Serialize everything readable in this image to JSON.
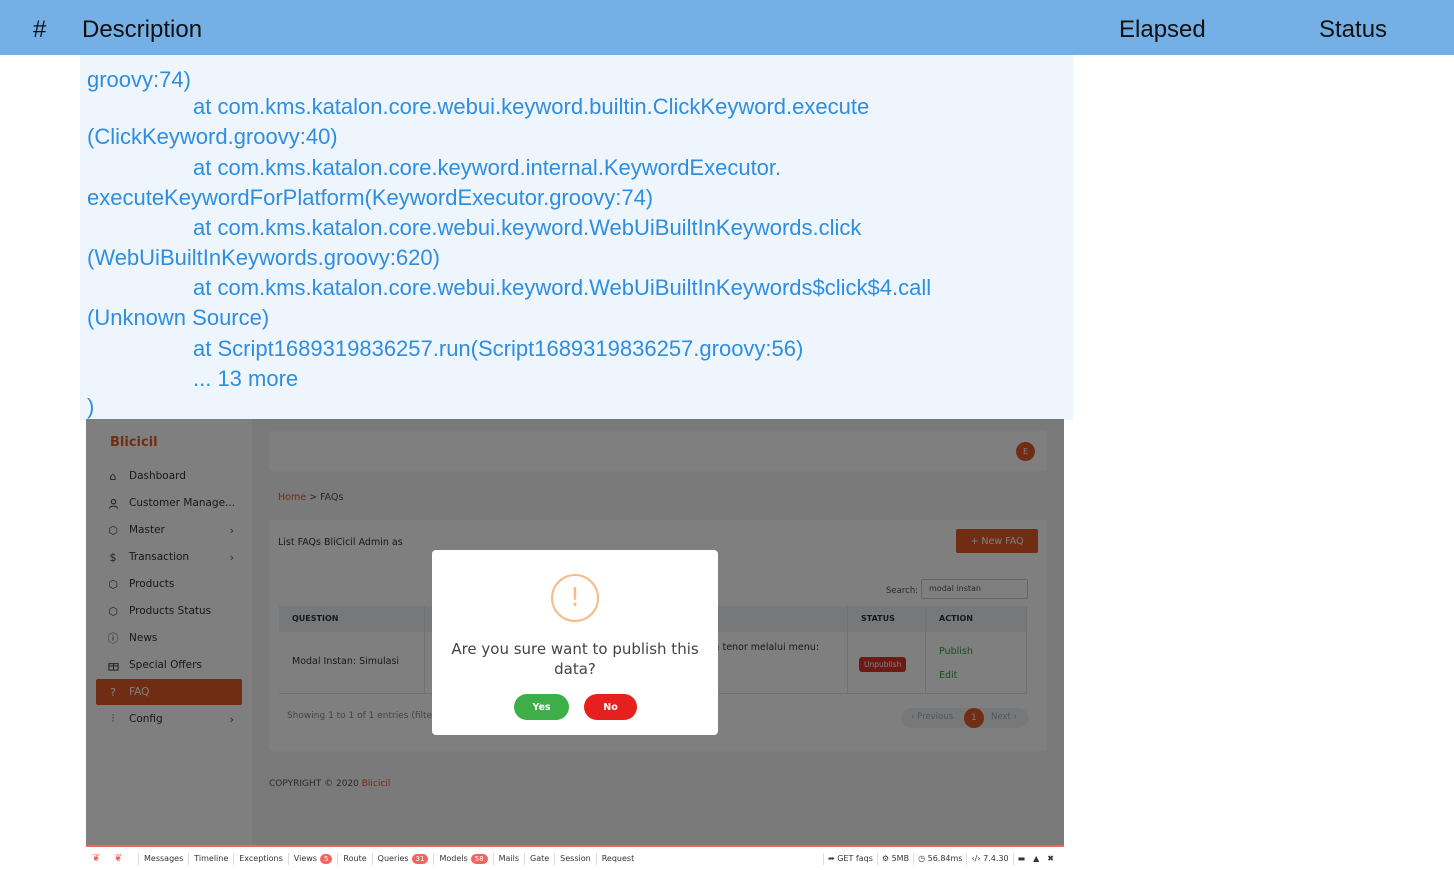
{
  "report_header": {
    "hash": "#",
    "description": "Description",
    "elapsed": "Elapsed",
    "status": "Status"
  },
  "log_lines": [
    "groovy:74)",
    "at com.kms.katalon.core.webui.keyword.builtin.ClickKeyword.execute",
    "(ClickKeyword.groovy:40)",
    "at com.kms.katalon.core.keyword.internal.KeywordExecutor.",
    "executeKeywordForPlatform(KeywordExecutor.groovy:74)",
    "at com.kms.katalon.core.webui.keyword.WebUiBuiltInKeywords.click",
    "(WebUiBuiltInKeywords.groovy:620)",
    "at com.kms.katalon.core.webui.keyword.WebUiBuiltInKeywords$click$4.call",
    "(Unknown Source)",
    "at Script1689319836257.run(Script1689319836257.groovy:56)",
    "... 13 more",
    ")"
  ],
  "app": {
    "brand": "Blicicil",
    "avatar_initial": "E",
    "menu": [
      {
        "label": "Dashboard",
        "icon": "home-icon"
      },
      {
        "label": "Customer Manage...",
        "icon": "user-icon"
      },
      {
        "label": "Master",
        "icon": "cube-icon",
        "chevron": "›"
      },
      {
        "label": "Transaction",
        "icon": "dollar-icon",
        "chevron": "›"
      },
      {
        "label": "Products",
        "icon": "cube-icon"
      },
      {
        "label": "Products Status",
        "icon": "cube-icon"
      },
      {
        "label": "News",
        "icon": "info-icon"
      },
      {
        "label": "Special Offers",
        "icon": "gift-icon"
      },
      {
        "label": "FAQ",
        "icon": "help-icon",
        "active": true
      },
      {
        "label": "Config",
        "icon": "sliders-icon",
        "chevron": "›"
      }
    ],
    "breadcrumb": {
      "home": "Home",
      "separator": ">",
      "current": "FAQs"
    },
    "card": {
      "title": "List FAQs BliCicil Admin as",
      "new_button": "+ New FAQ",
      "search_label": "Search:",
      "search_value": "modal instan"
    },
    "table": {
      "headers": [
        "QUESTION",
        "",
        "STATUS",
        "ACTION"
      ],
      "row": {
        "question": "Modal Instan: Simulasi",
        "answer_fragment": "n & tenor melalui menu:",
        "status": "Unpublish",
        "action_publish": "Publish",
        "action_edit": "Edit"
      }
    },
    "info": "Showing 1 to 1 of 1 entries (filtere",
    "pagination": {
      "previous": "‹ Previous",
      "current": "1",
      "next": "Next ›"
    },
    "footer": {
      "copyright": "COPYRIGHT © 2020",
      "brand": "Blicicil"
    },
    "modal": {
      "icon": "!",
      "title": "Are you sure want to publish this data?",
      "yes": "Yes",
      "no": "No"
    },
    "debugbar": {
      "tabs": [
        {
          "label": "Messages"
        },
        {
          "label": "Timeline"
        },
        {
          "label": "Exceptions"
        },
        {
          "label": "Views",
          "count": "5"
        },
        {
          "label": "Route"
        },
        {
          "label": "Queries",
          "count": "31"
        },
        {
          "label": "Models",
          "count": "58"
        },
        {
          "label": "Mails"
        },
        {
          "label": "Gate"
        },
        {
          "label": "Session"
        },
        {
          "label": "Request"
        }
      ],
      "right": [
        "GET faqs",
        "5MB",
        "56.84ms",
        "7.4.30"
      ]
    }
  }
}
